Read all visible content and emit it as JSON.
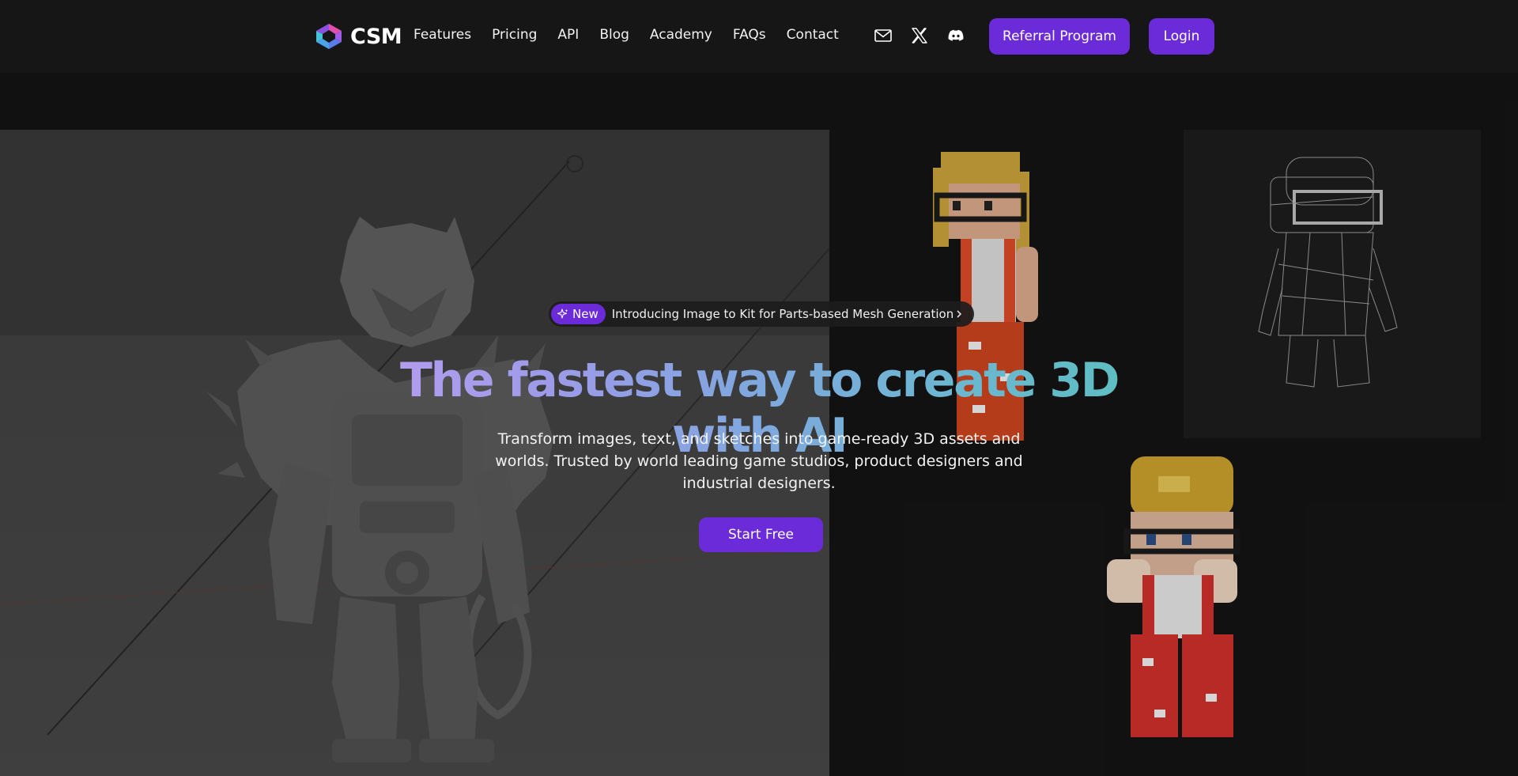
{
  "brand": {
    "name": "CSM",
    "accent": "#6c2bd9"
  },
  "nav": {
    "links": [
      "Features",
      "Pricing",
      "API",
      "Blog",
      "Academy",
      "FAQs",
      "Contact"
    ],
    "icons": [
      "mail-icon",
      "x-twitter-icon",
      "discord-icon"
    ],
    "referral_label": "Referral Program",
    "login_label": "Login"
  },
  "hero": {
    "announcement": {
      "badge": "New",
      "text": "Introducing Image to Kit for Parts-based Mesh Generation"
    },
    "headline": "The fastest way to create 3D with AI",
    "subtitle": "Transform  images, text, and sketches into game-ready 3D assets and worlds. Trusted by world leading game studios, product designers and industrial designers.",
    "cta_label": "Start Free"
  }
}
